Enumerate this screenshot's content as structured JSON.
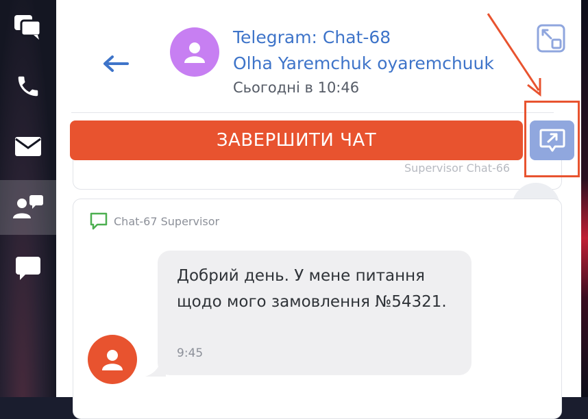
{
  "header": {
    "channel_title": "Telegram: Chat-68",
    "contact_name": "Olha Yaremchuk oyaremchuuk",
    "timestamp": "Сьогодні в 10:46"
  },
  "actions": {
    "end_chat_label": "ЗАВЕРШИТИ ЧАТ"
  },
  "previous_card": {
    "label": "Supervisor Chat-66"
  },
  "chat_card": {
    "label": "Chat-67 Supervisor",
    "message": {
      "text": "Добрий день. У мене питання щодо мого замовлення №54321.",
      "time": "9:45"
    }
  },
  "colors": {
    "accent": "#e8532f",
    "link": "#3e74c9",
    "header_avatar": "#c77ff2",
    "popout_button": "#90a7de",
    "chat_icon": "#4caf50"
  },
  "icons": {
    "rail": [
      "chats-icon",
      "phone-icon",
      "mail-icon",
      "contacts-icon",
      "chat-bubble-icon"
    ],
    "header": [
      "back-arrow-icon",
      "user-icon",
      "expand-icon",
      "popout-icon",
      "chevron-up-icon"
    ]
  }
}
